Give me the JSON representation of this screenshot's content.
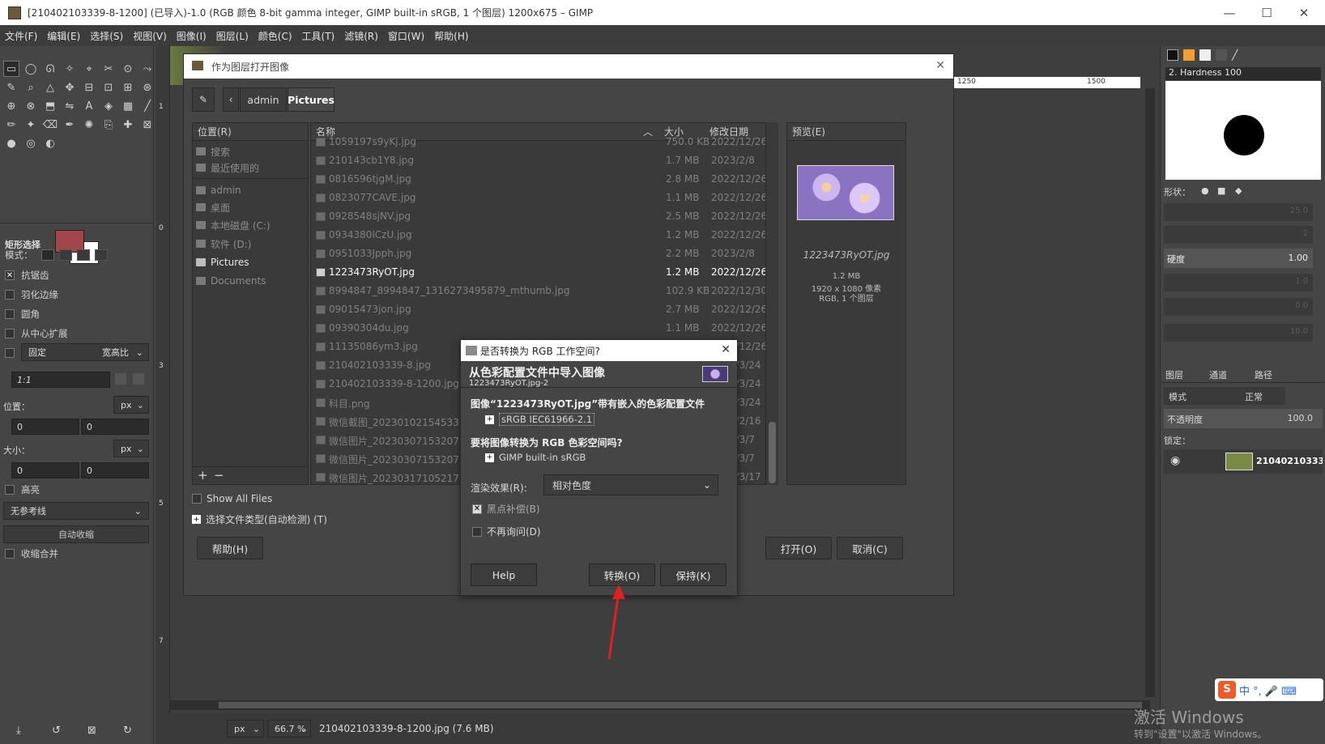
{
  "window": {
    "title": "[210402103339-8-1200] (已导入)-1.0 (RGB 颜色 8-bit gamma integer, GIMP built-in sRGB, 1 个图层) 1200x675 – GIMP",
    "min": "—",
    "max": "☐",
    "close": "✕"
  },
  "menu": [
    "文件(F)",
    "编辑(E)",
    "选择(S)",
    "视图(V)",
    "图像(I)",
    "图层(L)",
    "颜色(C)",
    "工具(T)",
    "滤镜(R)",
    "窗口(W)",
    "帮助(H)"
  ],
  "toolbox": {
    "tool_options_title": "矩形选择",
    "mode_label": "模式：",
    "antialias": "抗锯齿",
    "feather": "羽化边缘",
    "rounded": "圆角",
    "expand_center": "从中心扩展",
    "fixed": "固定",
    "aspect": "宽高比",
    "ratio_value": "1:1",
    "position_label": "位置：",
    "size_label": "大小：",
    "unit": "px",
    "pos_x": "0",
    "pos_y": "0",
    "size_w": "0",
    "size_h": "0",
    "highlight": "高亮",
    "guides": "无参考线",
    "auto_shrink": "自动收缩",
    "shrink_merged": "收缩合并"
  },
  "ruler": {
    "left_marks": [
      "1",
      "2",
      "3",
      "4",
      "5",
      "6",
      "7"
    ],
    "top_marks": [
      "1250",
      "1500"
    ],
    "zero": "0"
  },
  "file_dialog": {
    "title": "作为图层打开图像",
    "breadcrumb": [
      "admin",
      "Pictures"
    ],
    "places_header": "位置(R)",
    "places": [
      {
        "label": "搜索"
      },
      {
        "label": "最近使用的"
      },
      {
        "label": "admin"
      },
      {
        "label": "桌面"
      },
      {
        "label": "本地磁盘 (C:)"
      },
      {
        "label": "软件 (D:)"
      },
      {
        "label": "Pictures"
      },
      {
        "label": "Documents"
      }
    ],
    "columns": {
      "name": "名称",
      "size": "大小",
      "date": "修改日期"
    },
    "files": [
      {
        "name": "1059197s9yKj.jpg",
        "size": "750.0 KB",
        "date": "2022/12/26"
      },
      {
        "name": "210143cb1Y8.jpg",
        "size": "1.7 MB",
        "date": "2023/2/8"
      },
      {
        "name": "0816596tjgM.jpg",
        "size": "2.8 MB",
        "date": "2022/12/26"
      },
      {
        "name": "0823077CAVE.jpg",
        "size": "1.1 MB",
        "date": "2022/12/26"
      },
      {
        "name": "0928548sjNV.jpg",
        "size": "2.5 MB",
        "date": "2022/12/26"
      },
      {
        "name": "0934380lCzU.jpg",
        "size": "1.2 MB",
        "date": "2022/12/26"
      },
      {
        "name": "0951033Jpph.jpg",
        "size": "2.2 MB",
        "date": "2023/2/8"
      },
      {
        "name": "1223473RyOT.jpg",
        "size": "1.2 MB",
        "date": "2022/12/26"
      },
      {
        "name": "8994847_8994847_1316273495879_mthumb.jpg",
        "size": "102.9 KB",
        "date": "2022/12/30"
      },
      {
        "name": "09015473jon.jpg",
        "size": "2.7 MB",
        "date": "2022/12/26"
      },
      {
        "name": "09390304du.jpg",
        "size": "1.1 MB",
        "date": "2022/12/26"
      },
      {
        "name": "11135086ym3.jpg",
        "size": "",
        "date": "2022/12/26"
      },
      {
        "name": "210402103339-8.jpg",
        "size": "",
        "date": "2023/3/24"
      },
      {
        "name": "210402103339-8-1200.jpg",
        "size": "",
        "date": "2023/3/24"
      },
      {
        "name": "科目.png",
        "size": "",
        "date": "2023/3/24"
      },
      {
        "name": "微信截图_20230102154533",
        "size": "",
        "date": "2023/2/16"
      },
      {
        "name": "微信图片_20230307153207",
        "size": "",
        "date": "2023/3/7"
      },
      {
        "name": "微信图片_20230307153207",
        "size": "",
        "date": "2023/3/7"
      },
      {
        "name": "微信图片_20230317105217",
        "size": "",
        "date": "2023/3/17"
      }
    ],
    "preview_header": "预览(E)",
    "preview_name": "1223473RyOT.jpg",
    "preview_size": "1.2 MB",
    "preview_dims": "1920 x 1080 像素",
    "preview_mode": "RGB, 1 个图层",
    "show_all": "Show All Files",
    "file_type": "选择文件类型(自动检测) (T)",
    "help": "帮助(H)",
    "open": "打开(O)",
    "cancel": "取消(C)"
  },
  "convert_dialog": {
    "title": "是否转换为 RGB 工作空间?",
    "heading": "从色彩配置文件中导入图像",
    "sub": "1223473RyOT.jpg-2",
    "embedded_text": "图像“1223473RyOT.jpg”带有嵌入的色彩配置文件",
    "embedded_profile": "sRGB IEC61966-2.1",
    "convert_question": "要将图像转换为 RGB 色彩空间吗?",
    "target_profile": "GIMP built-in sRGB",
    "intent_label": "渲染效果(R):",
    "intent_value": "相对色度",
    "bpc": "黑点补偿(B)",
    "dont_ask": "不再询问(D)",
    "help": "Help",
    "convert": "转换(O)",
    "keep": "保持(K)"
  },
  "right_dock": {
    "brush_name": "2. Hardness 100",
    "shape_label": "形状：",
    "hardness_label": "硬度",
    "hardness_value": "1.00",
    "faded_values": [
      "25.0",
      "2",
      "1.0",
      "0.0",
      "10.0"
    ],
    "tabs": [
      "图层",
      "通道",
      "路径"
    ],
    "mode_label": "模式",
    "mode_value": "正常",
    "opacity_label": "不透明度",
    "opacity_value": "100.0",
    "lock_label": "锁定：",
    "layer_name": "210402103339"
  },
  "status": {
    "unit": "px",
    "zoom": "66.7 %",
    "file": "210402103339-8-1200.jpg (7.6 MB)"
  },
  "watermark": {
    "activate": "激活 Windows",
    "goto": "转到\"设置\"以激活 Windows。",
    "ime": "中 °, 🎤 ⌨"
  }
}
